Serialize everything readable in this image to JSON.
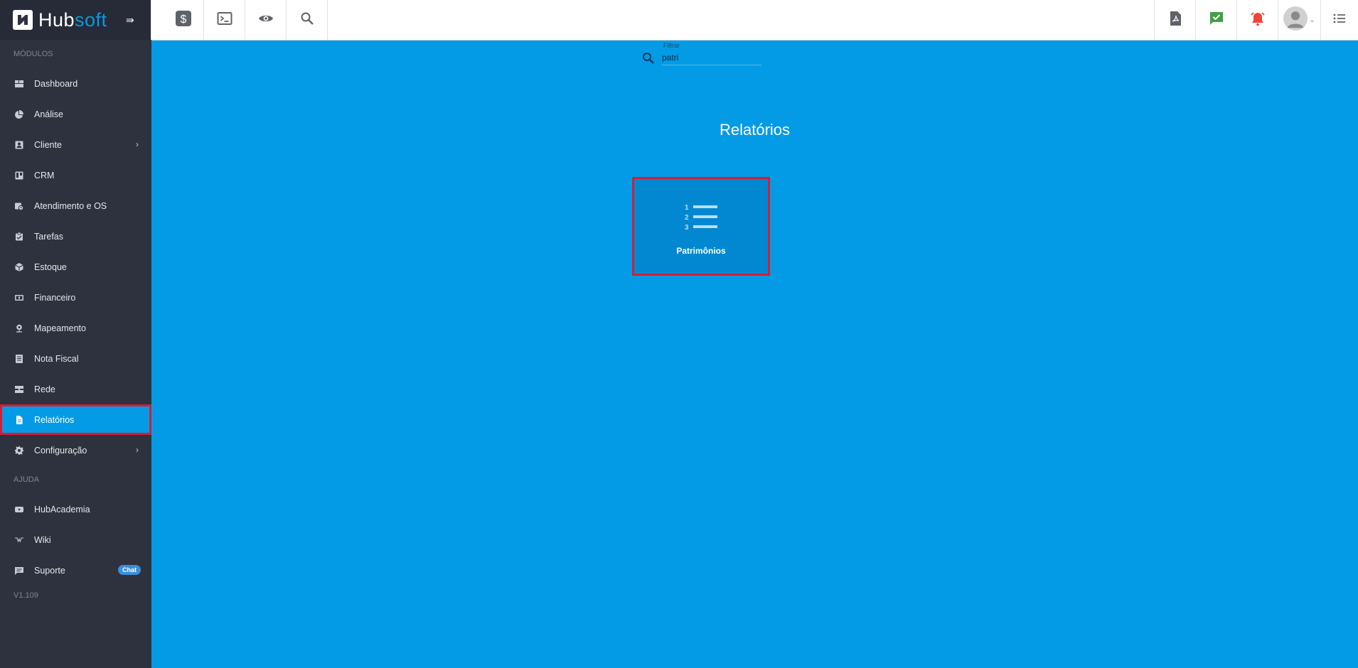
{
  "brand": {
    "hub": "Hub",
    "soft": "soft"
  },
  "sidebar": {
    "section_modules": "MÓDULOS",
    "items": [
      {
        "label": "Dashboard",
        "icon": "dashboard-icon"
      },
      {
        "label": "Análise",
        "icon": "pie-chart-icon"
      },
      {
        "label": "Cliente",
        "icon": "contact-icon",
        "expandable": true
      },
      {
        "label": "CRM",
        "icon": "trello-icon"
      },
      {
        "label": "Atendimento e OS",
        "icon": "calendar-clock-icon"
      },
      {
        "label": "Tarefas",
        "icon": "clipboard-icon"
      },
      {
        "label": "Estoque",
        "icon": "cube-icon"
      },
      {
        "label": "Financeiro",
        "icon": "money-icon"
      },
      {
        "label": "Mapeamento",
        "icon": "map-pin-icon"
      },
      {
        "label": "Nota Fiscal",
        "icon": "document-lines-icon"
      },
      {
        "label": "Rede",
        "icon": "server-icon"
      },
      {
        "label": "Relatórios",
        "icon": "file-icon",
        "active": true
      },
      {
        "label": "Configuração",
        "icon": "gear-icon",
        "expandable": true
      }
    ],
    "section_help": "AJUDA",
    "help_items": [
      {
        "label": "HubAcademia",
        "icon": "youtube-icon"
      },
      {
        "label": "Wiki",
        "icon": "wikipedia-icon"
      },
      {
        "label": "Suporte",
        "icon": "chat-icon",
        "badge": "Chat"
      }
    ],
    "version": "V1.109"
  },
  "topbar": {
    "left_buttons": [
      "dollar-icon",
      "terminal-icon",
      "eye-icon",
      "search-icon"
    ],
    "right_buttons": [
      "pdf-icon",
      "message-check-icon",
      "alarm-icon",
      "avatar",
      "list-icon"
    ]
  },
  "filter": {
    "label": "Filtrar",
    "value": "patri"
  },
  "main": {
    "title": "Relatórios",
    "cards": [
      {
        "label": "Patrimônios",
        "icon": "numbered-list-icon"
      }
    ]
  },
  "colors": {
    "sidebar_bg": "#2d323e",
    "accent": "#039be5",
    "highlight_border": "#d31f34",
    "card_bg": "#0288d1"
  }
}
